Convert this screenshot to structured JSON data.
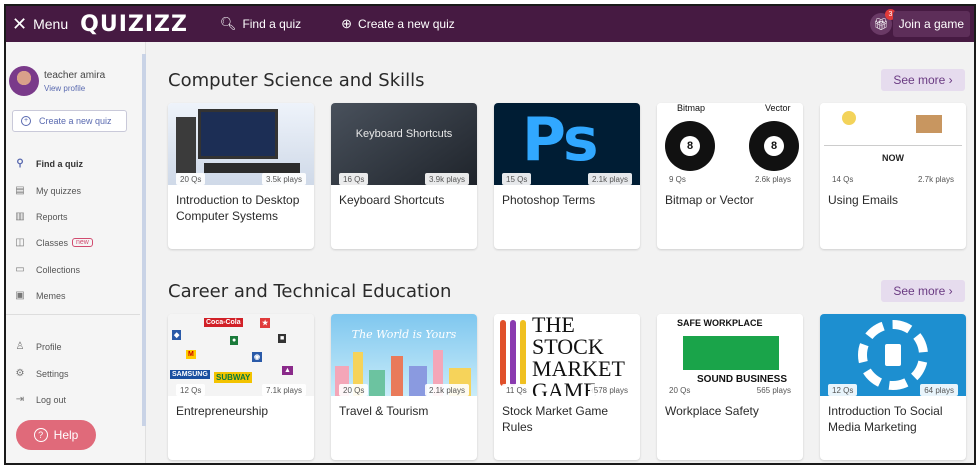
{
  "topbar": {
    "menu_label": "Menu",
    "logo": "QUIZIZZ",
    "find_quiz": "Find a quiz",
    "create_quiz": "Create a new quiz",
    "gift_badge": "3",
    "join_game": "Join a game"
  },
  "sidebar": {
    "user_name": "teacher amira",
    "view_profile": "View profile",
    "create_quiz": "Create a new quiz",
    "nav": [
      {
        "label": "Find a quiz",
        "icon": "search-icon",
        "active": true
      },
      {
        "label": "My quizzes",
        "icon": "document-icon"
      },
      {
        "label": "Reports",
        "icon": "bar-chart-icon"
      },
      {
        "label": "Classes",
        "icon": "classes-icon",
        "badge": "new"
      },
      {
        "label": "Collections",
        "icon": "folder-icon"
      },
      {
        "label": "Memes",
        "icon": "image-icon"
      }
    ],
    "bottom_nav": [
      {
        "label": "Profile",
        "icon": "user-icon"
      },
      {
        "label": "Settings",
        "icon": "gear-icon"
      },
      {
        "label": "Log out",
        "icon": "logout-icon"
      }
    ],
    "help": "Help"
  },
  "sections": [
    {
      "title": "Computer Science and Skills",
      "see_more": "See more ›",
      "cards": [
        {
          "title": "Introduction to Desktop Computer Systems",
          "qs": "20 Qs",
          "plays": "3.5k plays",
          "image_text": ""
        },
        {
          "title": "Keyboard Shortcuts",
          "qs": "16 Qs",
          "plays": "3.9k plays",
          "image_text": "Keyboard Shortcuts"
        },
        {
          "title": "Photoshop Terms",
          "qs": "15 Qs",
          "plays": "2.1k plays",
          "image_text": "Ps"
        },
        {
          "title": "Bitmap or Vector",
          "qs": "9 Qs",
          "plays": "2.6k plays",
          "image_text": "Bitmap",
          "image_text2": "Vector",
          "ball": "8"
        },
        {
          "title": "Using Emails",
          "qs": "14 Qs",
          "plays": "2.7k plays",
          "image_text": "NOW"
        }
      ]
    },
    {
      "title": "Career and Technical Education",
      "see_more": "See more ›",
      "cards": [
        {
          "title": "Entrepreneurship",
          "qs": "12 Qs",
          "plays": "7.1k plays",
          "image_text": "SUBWAY"
        },
        {
          "title": "Travel & Tourism",
          "qs": "20 Qs",
          "plays": "2.1k plays",
          "image_text": "The World is Yours"
        },
        {
          "title": "Stock Market Game Rules",
          "qs": "11 Qs",
          "plays": "578 plays",
          "image_text": "THE STOCK MARKET GAME"
        },
        {
          "title": "Workplace Safety",
          "qs": "20 Qs",
          "plays": "565 plays",
          "image_text": "SAFE WORKPLACE",
          "image_text2": "SOUND BUSINESS"
        },
        {
          "title": "Introduction To Social Media Marketing",
          "qs": "12 Qs",
          "plays": "64 plays",
          "image_text": ""
        }
      ]
    }
  ],
  "colors": {
    "topbar": "#461a42",
    "accent": "#6a3a82",
    "help": "#e06a7a"
  }
}
